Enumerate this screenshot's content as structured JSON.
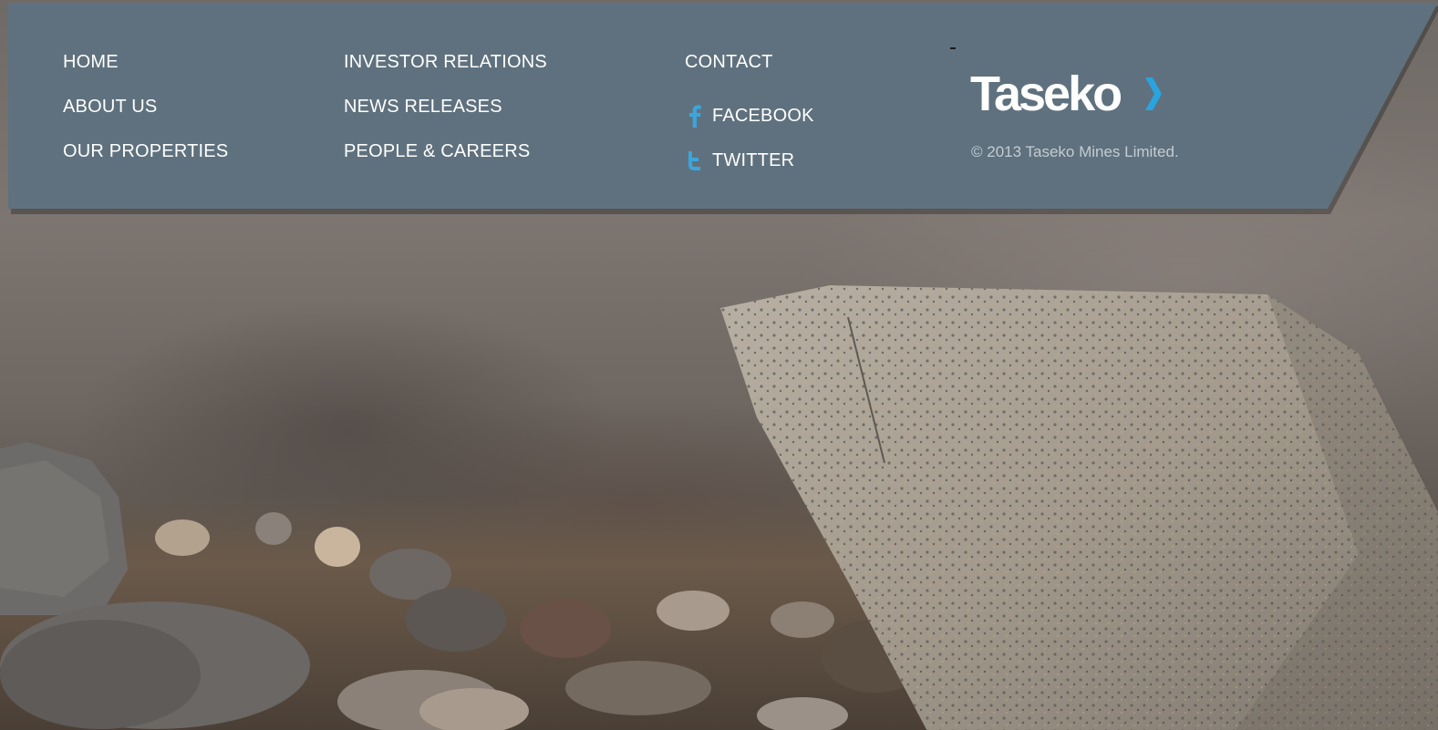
{
  "nav": {
    "col1": [
      "HOME",
      "ABOUT US",
      "OUR PROPERTIES"
    ],
    "col2": [
      "INVESTOR RELATIONS",
      "NEWS RELEASES",
      "PEOPLE & CAREERS"
    ],
    "contact": "CONTACT",
    "facebook": "FACEBOOK",
    "twitter": "TWITTER"
  },
  "brand": {
    "logo_text": "Taseko",
    "copyright": "© 2013 Taseko Mines Limited."
  },
  "colors": {
    "banner": "#5f717e",
    "social_icon": "#3aa6dc",
    "logo_chevron": "#2aa3de"
  }
}
